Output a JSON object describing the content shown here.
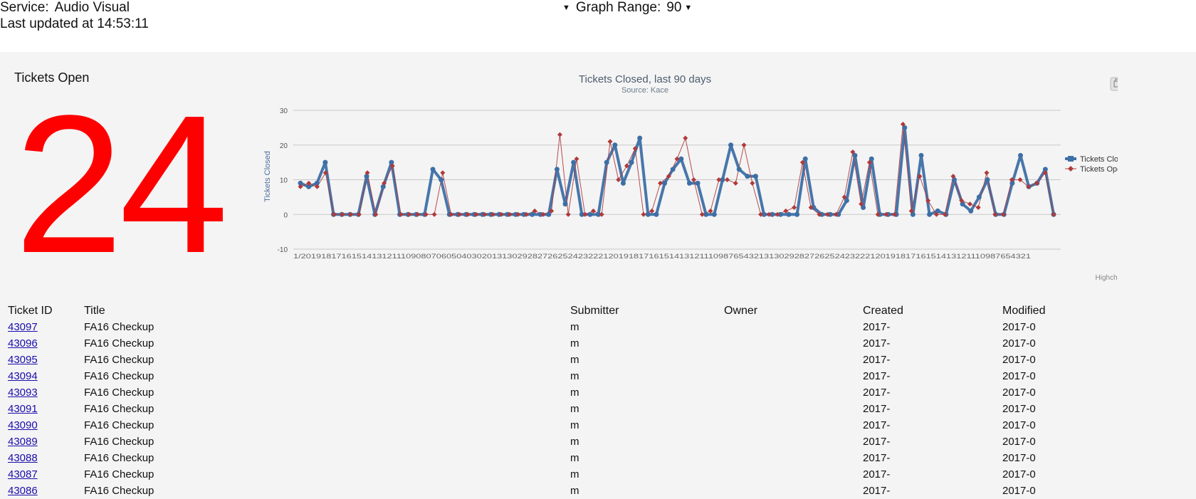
{
  "header": {
    "service_label": "Service:",
    "service_value": "Audio Visual",
    "updated_text": "Last updated at 14:53:11",
    "range_label": "Graph Range:",
    "range_value": "90"
  },
  "tickets_open": {
    "label": "Tickets Open",
    "count": "24"
  },
  "chart_data": {
    "type": "line",
    "title": "Tickets Closed, last 90 days",
    "subtitle": "Source: Kace",
    "ylabel": "Tickets Closed",
    "ylim": [
      -10,
      30
    ],
    "yticks": [
      "30",
      "20",
      "10",
      "0",
      "-10"
    ],
    "x_tick_text": "1/2019181716151413121110908070605040302013130292827262524232221201918171615141312111098765432131302928272625242322212019181716151413121110987654321",
    "credit": "Highcharts.com",
    "legend": "right",
    "colors": {
      "closed": "#3d6fa6",
      "opened": "#b03a3a"
    },
    "series": [
      {
        "name": "Tickets Closed",
        "values": [
          9,
          8,
          9,
          15,
          0,
          0,
          0,
          0,
          11,
          0,
          8,
          15,
          0,
          0,
          0,
          0,
          13,
          10,
          0,
          0,
          0,
          0,
          0,
          0,
          0,
          0,
          0,
          0,
          0,
          0,
          0,
          13,
          3,
          15,
          0,
          0,
          0,
          15,
          20,
          9,
          15,
          22,
          0,
          0,
          9,
          13,
          16,
          9,
          9,
          0,
          0,
          10,
          20,
          13,
          11,
          11,
          0,
          0,
          0,
          0,
          0,
          16,
          2,
          0,
          0,
          0,
          4,
          17,
          2,
          16,
          0,
          0,
          0,
          25,
          0,
          17,
          0,
          1,
          0,
          10,
          3,
          1,
          5,
          10,
          0,
          0,
          9,
          17,
          8,
          9,
          13,
          0
        ]
      },
      {
        "name": "Tickets Opened",
        "values": [
          8,
          9,
          8,
          12,
          0,
          0,
          0,
          0,
          12,
          0,
          9,
          14,
          0,
          0,
          0,
          0,
          0,
          12,
          0,
          0,
          0,
          0,
          0,
          0,
          0,
          0,
          0,
          0,
          1,
          0,
          1,
          23,
          0,
          16,
          0,
          1,
          0,
          21,
          10,
          14,
          19,
          0,
          1,
          9,
          11,
          16,
          22,
          10,
          0,
          1,
          10,
          10,
          9,
          20,
          9,
          0,
          0,
          0,
          1,
          2,
          15,
          2,
          0,
          0,
          0,
          5,
          18,
          3,
          15,
          0,
          0,
          0,
          26,
          1,
          11,
          4,
          0,
          0,
          11,
          4,
          3,
          2,
          12,
          0,
          0,
          10,
          10,
          8,
          9,
          12,
          0
        ]
      }
    ]
  },
  "tickets_table": {
    "headers": [
      "Ticket ID",
      "Title",
      "Submitter",
      "Owner",
      "Created",
      "Modified"
    ],
    "rows": [
      {
        "id": "43097",
        "title": "FA16 Checkup",
        "submitter": "m",
        "owner": "",
        "created": "2017-",
        "modified": "2017-0"
      },
      {
        "id": "43096",
        "title": "FA16 Checkup",
        "submitter": "m",
        "owner": "",
        "created": "2017-",
        "modified": "2017-0"
      },
      {
        "id": "43095",
        "title": "FA16 Checkup",
        "submitter": "m",
        "owner": "",
        "created": "2017-",
        "modified": "2017-0"
      },
      {
        "id": "43094",
        "title": "FA16 Checkup",
        "submitter": "m",
        "owner": "",
        "created": "2017-",
        "modified": "2017-0"
      },
      {
        "id": "43093",
        "title": "FA16 Checkup",
        "submitter": "m",
        "owner": "",
        "created": "2017-",
        "modified": "2017-0"
      },
      {
        "id": "43091",
        "title": "FA16 Checkup",
        "submitter": "m",
        "owner": "",
        "created": "2017-",
        "modified": "2017-0"
      },
      {
        "id": "43090",
        "title": "FA16 Checkup",
        "submitter": "m",
        "owner": "",
        "created": "2017-",
        "modified": "2017-0"
      },
      {
        "id": "43089",
        "title": "FA16 Checkup",
        "submitter": "m",
        "owner": "",
        "created": "2017-",
        "modified": "2017-0"
      },
      {
        "id": "43088",
        "title": "FA16 Checkup",
        "submitter": "m",
        "owner": "",
        "created": "2017-",
        "modified": "2017-0"
      },
      {
        "id": "43087",
        "title": "FA16 Checkup",
        "submitter": "m",
        "owner": "",
        "created": "2017-",
        "modified": "2017-0"
      },
      {
        "id": "43086",
        "title": "FA16 Checkup",
        "submitter": "m",
        "owner": "",
        "created": "2017-",
        "modified": "2017-0"
      }
    ]
  }
}
